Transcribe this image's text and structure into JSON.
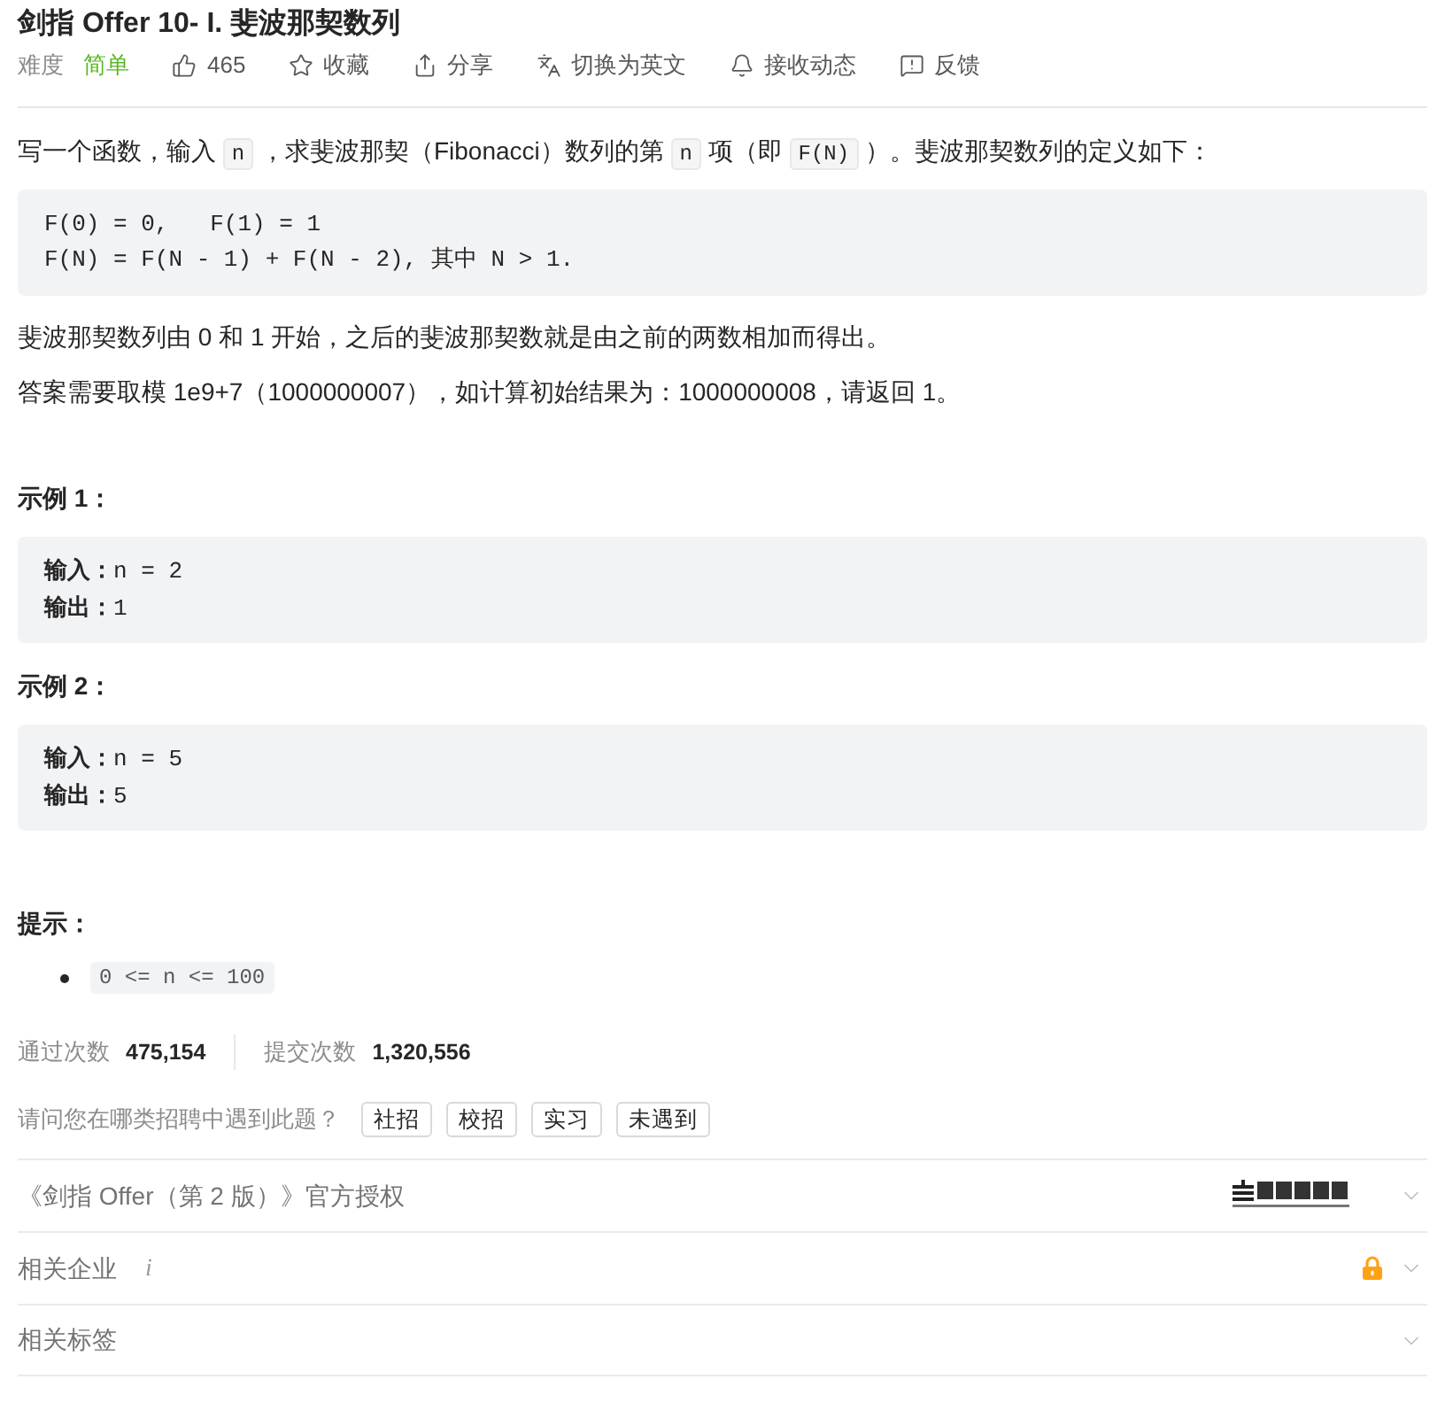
{
  "title": "剑指 Offer 10- I. 斐波那契数列",
  "meta": {
    "difficulty_label": "难度",
    "difficulty": {
      "label": "简单",
      "kind": "easy"
    },
    "actions": [
      {
        "kind": "like",
        "label": "465"
      },
      {
        "kind": "star",
        "label": "收藏"
      },
      {
        "kind": "share",
        "label": "分享"
      },
      {
        "kind": "translate",
        "label": "切换为英文"
      },
      {
        "kind": "bell",
        "label": "接收动态"
      },
      {
        "kind": "feedback",
        "label": "反馈"
      }
    ]
  },
  "statement": [
    {
      "kind": "paragraph",
      "segments": [
        {
          "kind": "text",
          "text": "写一个函数，输入 "
        },
        {
          "kind": "code",
          "text": "n"
        },
        {
          "kind": "text",
          "text": " ，求斐波那契（Fibonacci）数列的第 "
        },
        {
          "kind": "code",
          "text": "n"
        },
        {
          "kind": "text",
          "text": " 项（即 "
        },
        {
          "kind": "code",
          "text": "F(N)"
        },
        {
          "kind": "text",
          "text": " ）。斐波那契数列的定义如下："
        }
      ]
    },
    {
      "kind": "code",
      "lines": [
        "F(0) = 0,   F(1) = 1",
        "F(N) = F(N - 1) + F(N - 2), 其中 N > 1."
      ]
    },
    {
      "kind": "paragraph",
      "segments": [
        {
          "kind": "text",
          "text": "斐波那契数列由 0 和 1 开始，之后的斐波那契数就是由之前的两数相加而得出。"
        }
      ]
    },
    {
      "kind": "paragraph",
      "segments": [
        {
          "kind": "text",
          "text": "答案需要取模 1e9+7（1000000007），如计算初始结果为：1000000008，请返回 1。"
        }
      ]
    }
  ],
  "examples": [
    {
      "heading": "示例 1：",
      "lines": [
        {
          "label": "输入：",
          "value": "n = 2"
        },
        {
          "label": "输出：",
          "value": "1"
        }
      ]
    },
    {
      "heading": "示例 2：",
      "lines": [
        {
          "label": "输入：",
          "value": "n = 5"
        },
        {
          "label": "输出：",
          "value": "5"
        }
      ]
    }
  ],
  "constraints": {
    "heading": "提示：",
    "items": [
      "0 <= n <= 100"
    ]
  },
  "stats": [
    {
      "label": "通过次数",
      "value": "475,154"
    },
    {
      "label": "提交次数",
      "value": "1,320,556"
    }
  ],
  "survey": {
    "question": "请问您在哪类招聘中遇到此题？",
    "options": [
      {
        "label": "社招",
        "selected": false
      },
      {
        "label": "校招",
        "selected": false
      },
      {
        "label": "实习",
        "selected": false
      },
      {
        "label": "未遇到",
        "selected": false
      }
    ]
  },
  "panels": [
    {
      "kind": "license",
      "title": "《剑指 Offer（第 2 版）》官方授权",
      "expanded": false
    },
    {
      "kind": "companies",
      "title": "相关企业",
      "hint": "i",
      "locked": true,
      "expanded": false
    },
    {
      "kind": "tags",
      "title": "相关标签",
      "expanded": false
    }
  ]
}
